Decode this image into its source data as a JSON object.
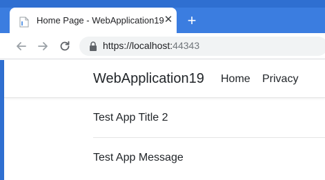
{
  "browser": {
    "tab": {
      "title": "Home Page - WebApplication19",
      "close_glyph": "✕",
      "favicon_icon": "page-icon"
    },
    "new_tab_glyph": "+",
    "toolbar": {
      "back_icon": "arrow-left-icon",
      "forward_icon": "arrow-right-icon",
      "reload_icon": "reload-icon",
      "lock_icon": "lock-icon",
      "url_host": "https://localhost:",
      "url_port": "44343"
    },
    "colors": {
      "tabstrip": "#3b7de0",
      "tabstrip_top": "#2f6fd1",
      "omnibox": "#f1f3f4"
    }
  },
  "page": {
    "brand": "WebApplication19",
    "nav": {
      "home": "Home",
      "privacy": "Privacy"
    },
    "items": [
      {
        "text": "Test App Title 2"
      },
      {
        "text": "Test App Message"
      }
    ]
  }
}
